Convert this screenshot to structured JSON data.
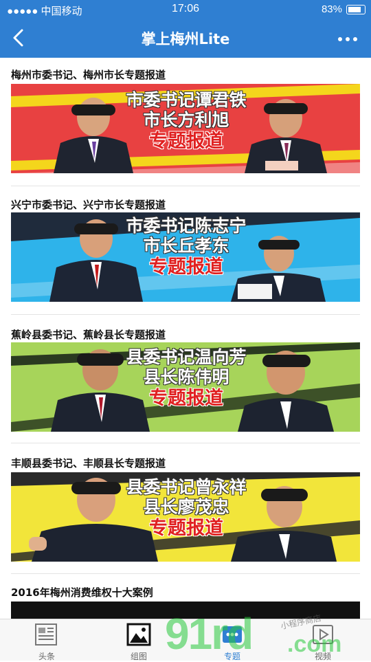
{
  "status_bar": {
    "carrier": "●●●●● 中国移动",
    "time": "17:06",
    "battery": "83%"
  },
  "nav": {
    "title": "掌上梅州Lite"
  },
  "items": [
    {
      "headline": "梅州市委书记、梅州市长专题报道",
      "banner_line1": "市委书记谭君铁",
      "banner_line2": "市长方利旭",
      "banner_line3": "专题报道",
      "bg": "#e84141",
      "stripe": "#f4d61c",
      "nameplate": "方利旭"
    },
    {
      "headline": "兴宁市委书记、兴宁市长专题报道",
      "banner_line1": "市委书记陈志宁",
      "banner_line2": "市长丘孝东",
      "banner_line3": "专题报道",
      "bg": "#2eb3ea",
      "stripe": "#1f2b3c",
      "nameplate": "丘孝东"
    },
    {
      "headline": "蕉岭县委书记、蕉岭县长专题报道",
      "banner_line1": "县委书记温向芳",
      "banner_line2": "县长陈伟明",
      "banner_line3": "专题报道",
      "bg": "#a7d45a",
      "stripe": "#2a3a20",
      "nameplate": ""
    },
    {
      "headline": "丰顺县委书记、丰顺县长专题报道",
      "banner_line1": "县委书记曾永祥",
      "banner_line2": "县长廖茂忠",
      "banner_line3": "专题报道",
      "bg": "#f2e53a",
      "stripe": "#2a2a2a",
      "nameplate": ""
    },
    {
      "headline": "2016年梅州消费维权十大案例"
    }
  ],
  "tabs": [
    {
      "label": "头条",
      "icon": "newspaper-icon"
    },
    {
      "label": "组图",
      "icon": "picture-icon"
    },
    {
      "label": "专题",
      "icon": "topic-icon"
    },
    {
      "label": "视频",
      "icon": "video-icon"
    }
  ],
  "watermark": {
    "main": "91rd",
    "domain": ".com",
    "small": "小程序商店"
  },
  "colors": {
    "brand": "#2f7fd2"
  }
}
